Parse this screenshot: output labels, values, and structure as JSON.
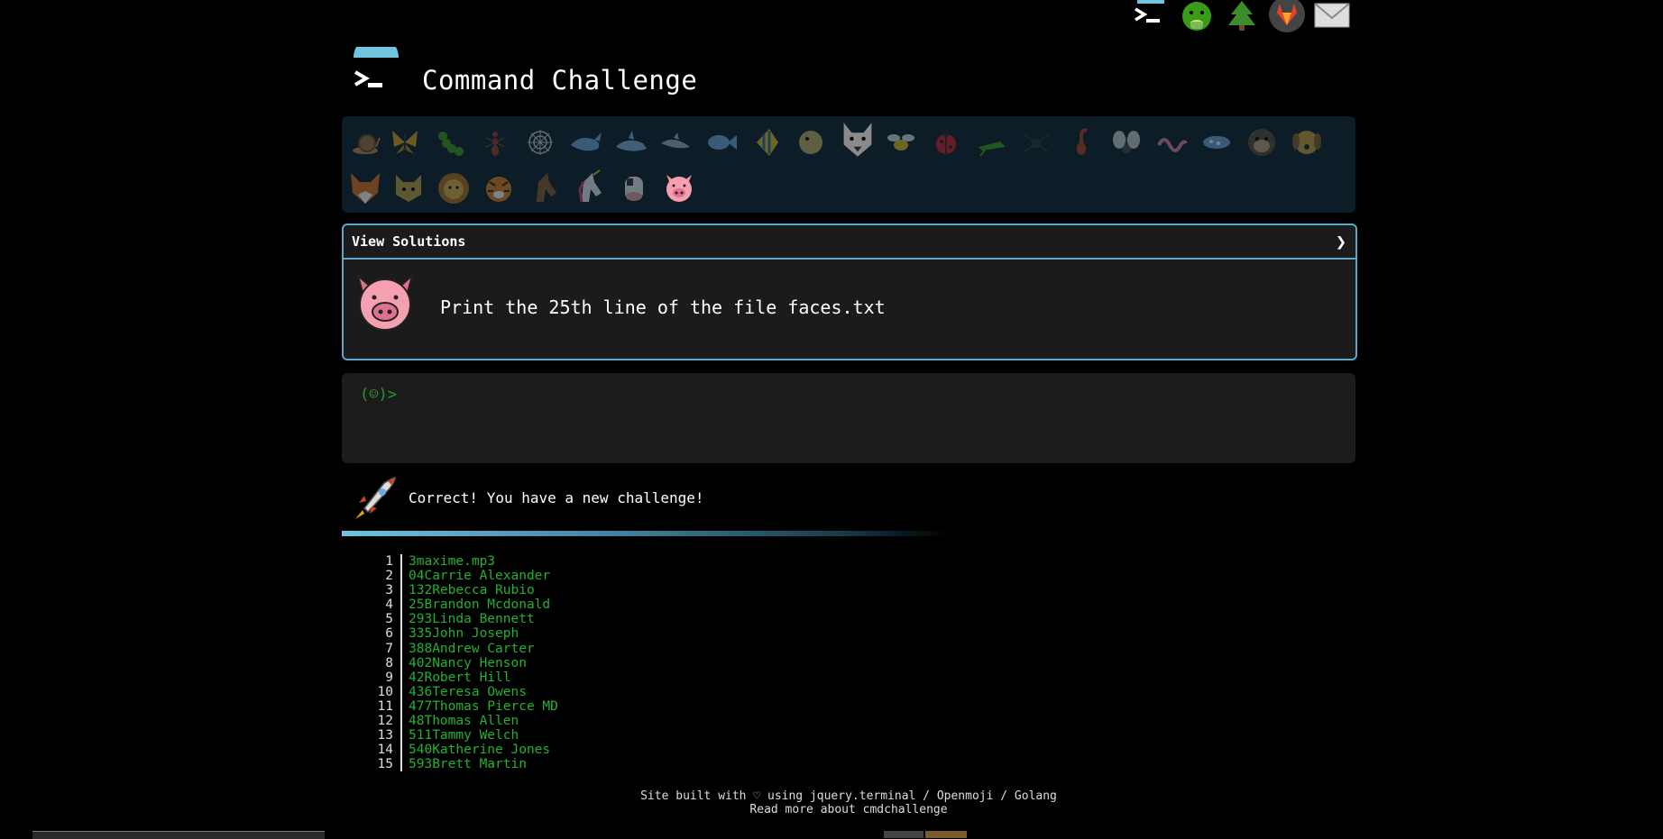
{
  "header": {
    "title": "Command Challenge"
  },
  "top_icons": [
    "terminal-icon",
    "nauseated-face-icon",
    "tree-icon",
    "gitlab-icon",
    "mail-icon"
  ],
  "emoji_bar": {
    "items": [
      "snail",
      "butterfly",
      "caterpillar",
      "ant",
      "spider-web",
      "whale",
      "shark",
      "dolphin",
      "fish",
      "tropical-fish",
      "blowfish",
      "wolf",
      "bee",
      "ladybug",
      "cricket",
      "spider",
      "scorpion",
      "fly",
      "worm",
      "microbe",
      "gorilla",
      "dog",
      "fox",
      "cat",
      "lion",
      "tiger",
      "horse",
      "unicorn",
      "cow",
      "pig"
    ],
    "current": "pig"
  },
  "challenge": {
    "solutions_label": "View Solutions",
    "chevron": "❯",
    "text": "Print the 25th line of the file faces.txt"
  },
  "terminal": {
    "prompt": "(☺)>"
  },
  "status": {
    "text": "Correct! You have a new challenge!"
  },
  "files": [
    {
      "n": "1",
      "name": "3maxime.mp3"
    },
    {
      "n": "2",
      "name": "04Carrie Alexander"
    },
    {
      "n": "3",
      "name": "132Rebecca Rubio"
    },
    {
      "n": "4",
      "name": "25Brandon Mcdonald"
    },
    {
      "n": "5",
      "name": "293Linda Bennett"
    },
    {
      "n": "6",
      "name": "335John Joseph"
    },
    {
      "n": "7",
      "name": "388Andrew Carter"
    },
    {
      "n": "8",
      "name": "402Nancy Henson"
    },
    {
      "n": "9",
      "name": "42Robert Hill"
    },
    {
      "n": "10",
      "name": "436Teresa Owens"
    },
    {
      "n": "11",
      "name": "477Thomas Pierce MD"
    },
    {
      "n": "12",
      "name": "48Thomas Allen"
    },
    {
      "n": "13",
      "name": "511Tammy Welch"
    },
    {
      "n": "14",
      "name": "540Katherine Jones"
    },
    {
      "n": "15",
      "name": "593Brett Martin"
    }
  ],
  "footer": {
    "line1": "Site built with ♡ using jquery.terminal / Openmoji / Golang",
    "line2": "Read more about cmdchallenge"
  }
}
